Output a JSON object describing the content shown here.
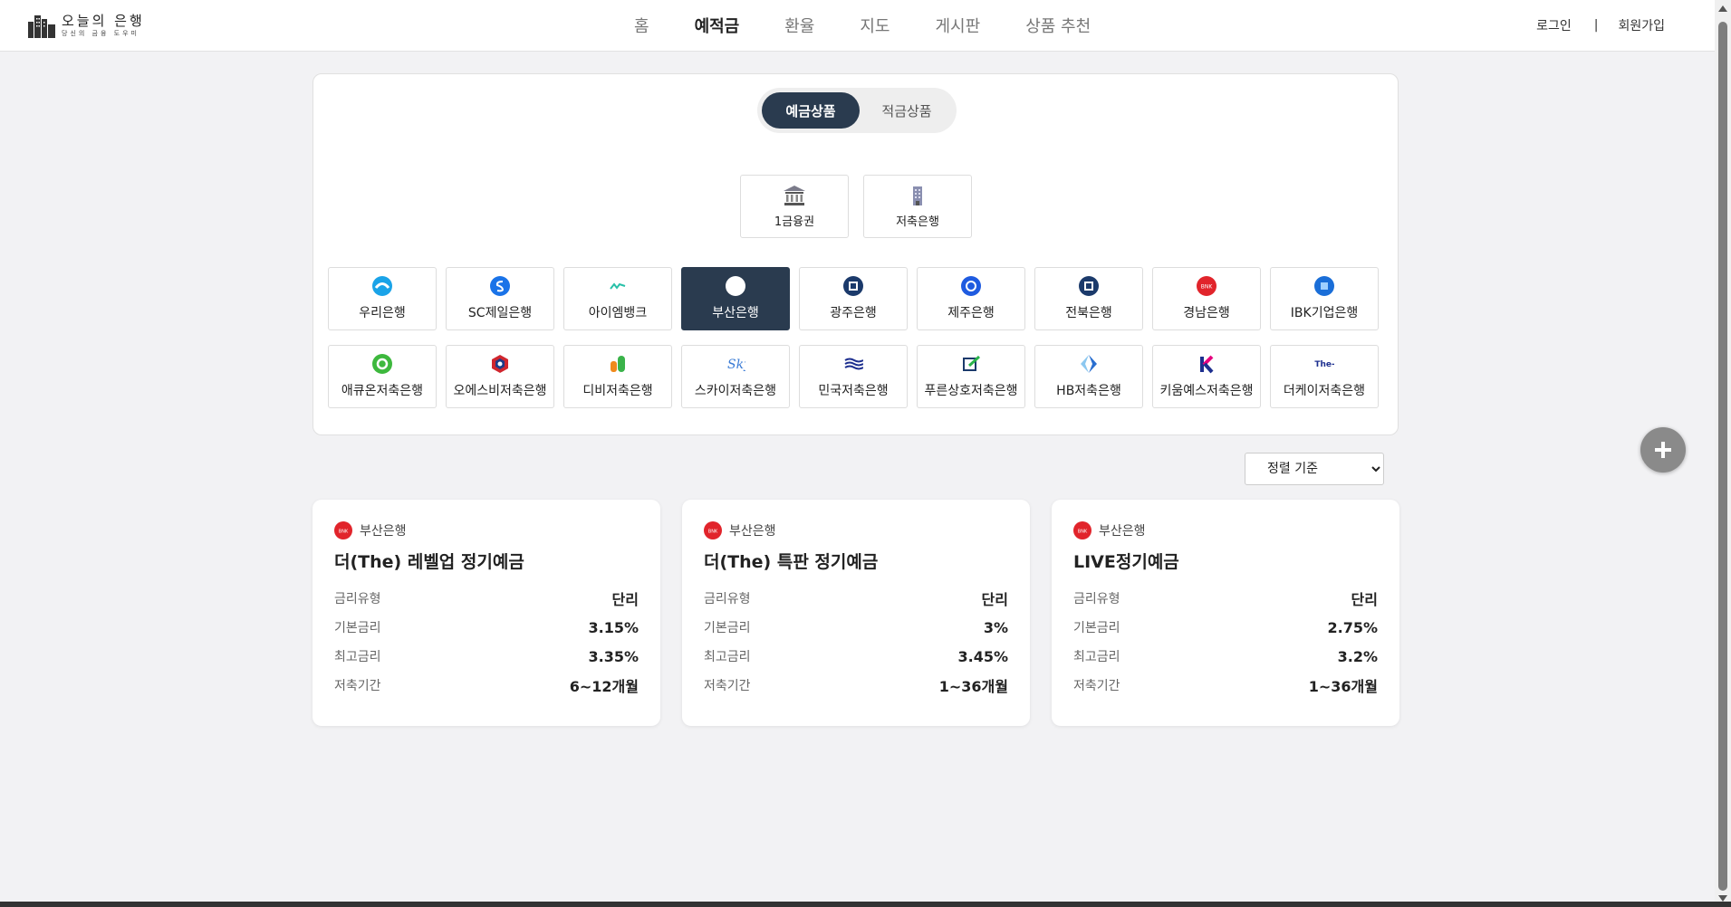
{
  "header": {
    "logo_title": "오늘의 은행",
    "logo_sub": "당신의 금융 도우미",
    "nav": [
      "홈",
      "예적금",
      "환율",
      "지도",
      "게시판",
      "상품 추천"
    ],
    "login": "로그인",
    "separator": "|",
    "signup": "회원가입"
  },
  "toggle": {
    "deposit": "예금상품",
    "savings": "적금상품"
  },
  "types": {
    "first": "1금융권",
    "savings_bank": "저축은행"
  },
  "banks_row1": [
    "우리은행",
    "SC제일은행",
    "아이엠뱅크",
    "부산은행",
    "광주은행",
    "제주은행",
    "전북은행",
    "경남은행",
    "IBK기업은행"
  ],
  "banks_row2": [
    "애큐온저축은행",
    "오에스비저축은행",
    "디비저축은행",
    "스카이저축은행",
    "민국저축은행",
    "푸른상호저축은행",
    "HB저축은행",
    "키움예스저축은행",
    "더케이저축은행"
  ],
  "icon_names_row1": [
    "woori-bank-icon",
    "sc-bank-icon",
    "imbank-icon",
    "busan-bank-icon",
    "gwangju-bank-icon",
    "jeju-bank-icon",
    "jeonbuk-bank-icon",
    "kyongnam-bank-icon",
    "ibk-bank-icon"
  ],
  "icon_names_row2": [
    "acuon-icon",
    "osb-icon",
    "db-icon",
    "sky-icon",
    "minkook-icon",
    "pureun-icon",
    "hb-icon",
    "kiwoom-icon",
    "thek-icon"
  ],
  "icon_text": {
    "sky": "Sky",
    "thek": "The-K",
    "bnk": "BNK"
  },
  "colors": {
    "accent": "#2a3b4f",
    "busan_red": "#e1242b"
  },
  "sort": {
    "label": "정렬 기준"
  },
  "labels": {
    "rate_type": "금리유형",
    "base_rate": "기본금리",
    "max_rate": "최고금리",
    "period": "저축기간"
  },
  "products": [
    {
      "bank": "부산은행",
      "title": "더(The) 레벨업 정기예금",
      "rate_type": "단리",
      "base_rate": "3.15%",
      "max_rate": "3.35%",
      "period": "6~12개월"
    },
    {
      "bank": "부산은행",
      "title": "더(The) 특판 정기예금",
      "rate_type": "단리",
      "base_rate": "3%",
      "max_rate": "3.45%",
      "period": "1~36개월"
    },
    {
      "bank": "부산은행",
      "title": "LIVE정기예금",
      "rate_type": "단리",
      "base_rate": "2.75%",
      "max_rate": "3.2%",
      "period": "1~36개월"
    }
  ]
}
